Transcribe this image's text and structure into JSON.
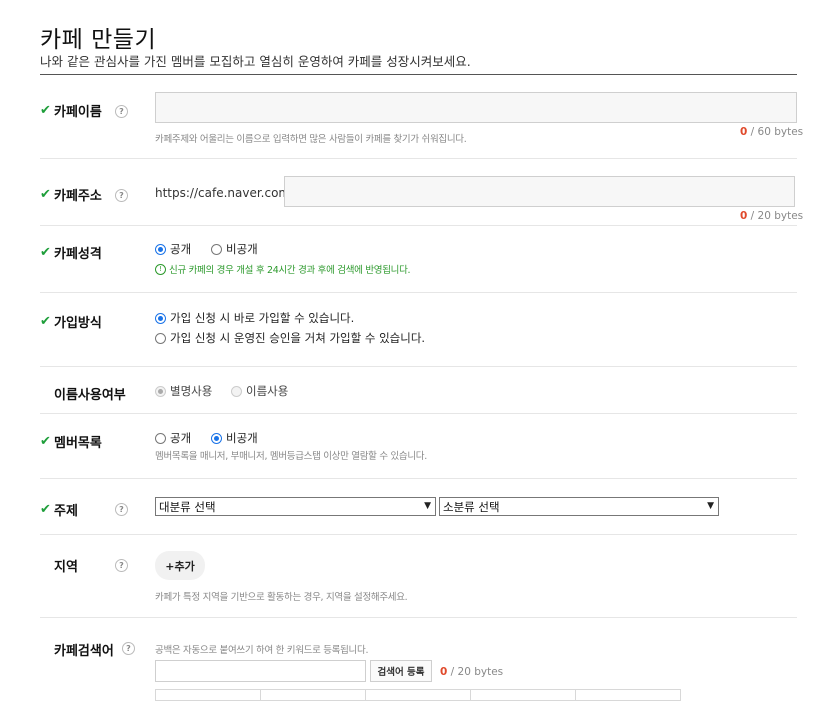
{
  "header": {
    "title": "카페 만들기",
    "subtitle": "나와 같은 관심사를 가진 멤버를 모집하고 열심히 운영하여 카페를 성장시켜보세요."
  },
  "cafe_name": {
    "label": "카페이름",
    "value": "",
    "byte_count": "0",
    "byte_limit": "/ 60 bytes",
    "hint": "카페주제와 어울리는 이름으로 입력하면 많은 사람들이 카페를 찾기가 쉬워집니다."
  },
  "cafe_address": {
    "label": "카페주소",
    "prefix": "https://cafe.naver.com/",
    "value": "",
    "byte_count": "0",
    "byte_limit": "/ 20 bytes"
  },
  "cafe_type": {
    "label": "카페성격",
    "options": [
      "공개",
      "비공개"
    ],
    "selected": "공개",
    "notice": "신규 카페의 경우 개설 후 24시간 경과 후에 검색에 반영됩니다."
  },
  "join_method": {
    "label": "가입방식",
    "options": [
      "가입 신청 시 바로 가입할 수 있습니다.",
      "가입 신청 시 운영진 승인을 거쳐 가입할 수 있습니다."
    ],
    "selected": "가입 신청 시 바로 가입할 수 있습니다."
  },
  "name_usage": {
    "label": "이름사용여부",
    "options": [
      "별명사용",
      "이름사용"
    ],
    "selected": "별명사용"
  },
  "member_list": {
    "label": "멤버목록",
    "options": [
      "공개",
      "비공개"
    ],
    "selected": "비공개",
    "hint": "멤버목록을 매니저, 부매니저, 멤버등급스탭 이상만 열람할 수 있습니다."
  },
  "topic": {
    "label": "주제",
    "major_select": "대분류 선택",
    "minor_select": "소분류 선택"
  },
  "region": {
    "label": "지역",
    "add_label": "+추가",
    "hint": "카페가 특정 지역을 기반으로 활동하는 경우, 지역을 설정해주세요."
  },
  "keywords": {
    "label": "카페검색어",
    "hint": "공백은 자동으로 붙여쓰기 하여 한 키워드로 등록됩니다.",
    "value": "",
    "register_label": "검색어 등록",
    "byte_count": "0",
    "byte_limit": "/ 20 bytes"
  },
  "colors": {
    "check": "#1e9e3a",
    "byte_count": "#e0492b",
    "radio_selected": "#1a73e8"
  },
  "icons": {
    "required": "check-icon",
    "help": "help-icon"
  }
}
